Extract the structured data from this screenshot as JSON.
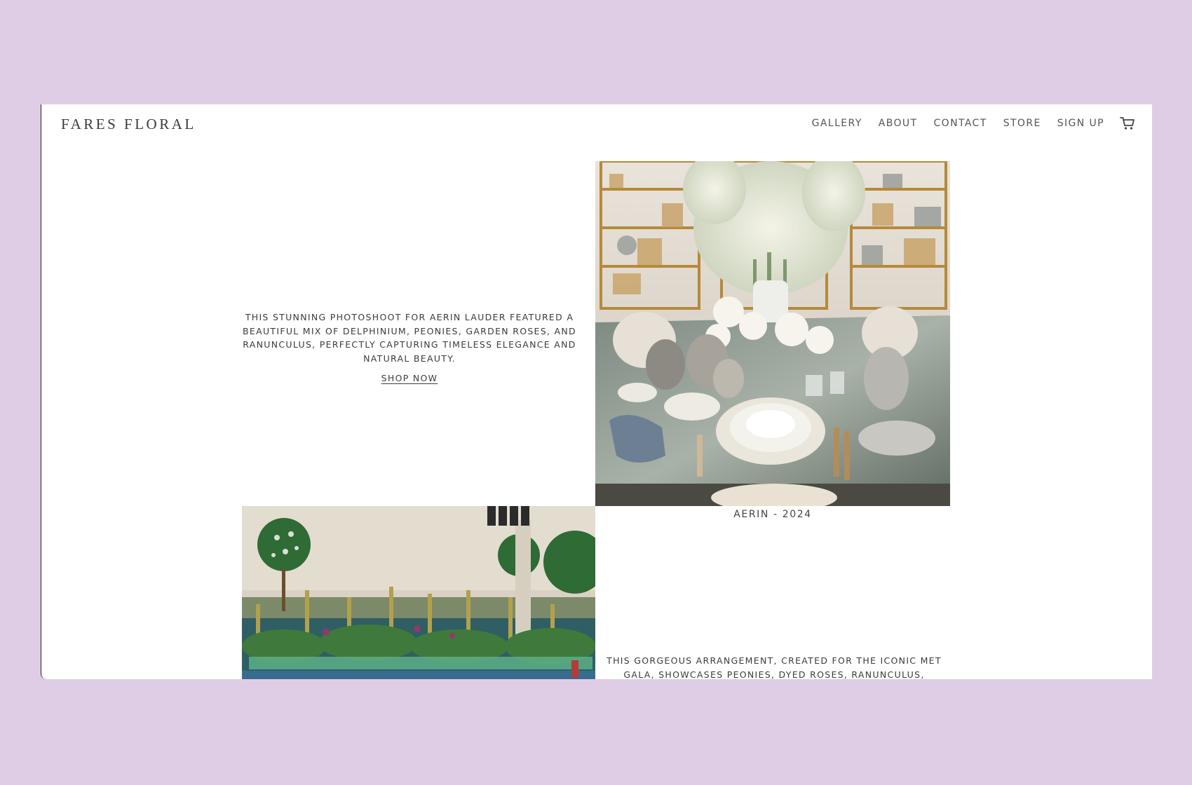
{
  "brand": {
    "logo": "FARES FLORAL"
  },
  "nav": {
    "items": [
      "GALLERY",
      "ABOUT",
      "CONTACT",
      "STORE",
      "SIGN UP"
    ],
    "cart_icon": "cart-icon"
  },
  "projects": [
    {
      "description": "THIS STUNNING PHOTOSHOOT FOR AERIN LAUDER FEATURED A BEAUTIFUL MIX OF DELPHINIUM, PEONIES, GARDEN ROSES, AND RANUNCULUS, PERFECTLY CAPTURING TIMELESS ELEGANCE AND NATURAL BEAUTY.",
      "link_label": "SHOP NOW",
      "caption": "AERIN - 2024"
    },
    {
      "description": "THIS GORGEOUS ARRANGEMENT, CREATED FOR THE ICONIC MET GALA, SHOWCASES PEONIES, DYED ROSES, RANUNCULUS, PRESERVED ROSES, AND"
    }
  ],
  "colors": {
    "page_background": "#dfcde6",
    "window_background": "#ffffff",
    "text": "#3b3b3b"
  }
}
